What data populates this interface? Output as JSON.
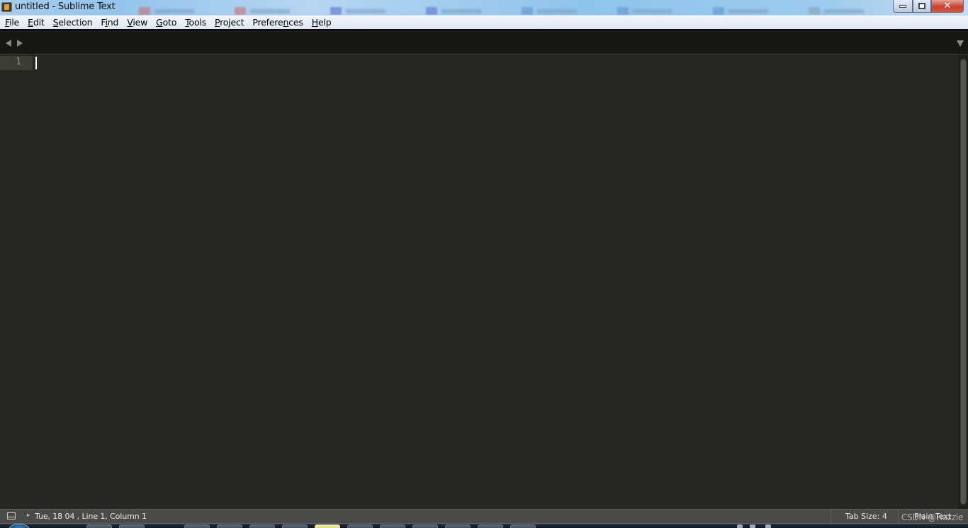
{
  "window": {
    "title": "untitled - Sublime Text",
    "controls": {
      "minimize": "minimize",
      "maximize": "restore",
      "close": "close"
    }
  },
  "menu": {
    "items": [
      {
        "label": "File",
        "accel": "F"
      },
      {
        "label": "Edit",
        "accel": "E"
      },
      {
        "label": "Selection",
        "accel": "S"
      },
      {
        "label": "Find",
        "accel": "i"
      },
      {
        "label": "View",
        "accel": "V"
      },
      {
        "label": "Goto",
        "accel": "G"
      },
      {
        "label": "Tools",
        "accel": "T"
      },
      {
        "label": "Project",
        "accel": "P"
      },
      {
        "label": "Preferences",
        "accel": "n"
      },
      {
        "label": "Help",
        "accel": "H"
      }
    ]
  },
  "tabstrip": {
    "icons": [
      "tab-scroll-left-icon",
      "tab-scroll-right-icon",
      "tab-list-dropdown-icon"
    ]
  },
  "editor": {
    "line_numbers": [
      "1"
    ],
    "content": "",
    "cursor": {
      "line": 1,
      "column": 1
    }
  },
  "statusbar": {
    "status_text": "Tue, 18 04 , Line 1, Column 1",
    "tab_size": "Tab Size: 4",
    "syntax": "Plain Text",
    "watermark": "CSDN @Hazzie"
  },
  "colors": {
    "editor_bg": "#272822",
    "gutter_highlight": "#3e3d32",
    "tabstrip_bg": "#171813",
    "statusbar_bg": "#4a4b47",
    "caret": "#f8f8f0"
  }
}
